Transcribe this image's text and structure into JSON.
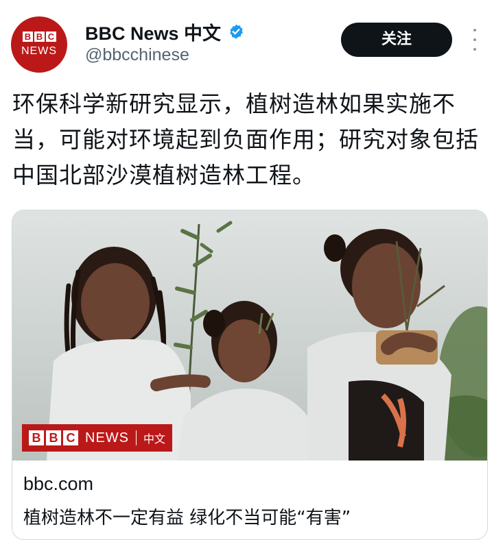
{
  "account": {
    "display_name": "BBC News 中文",
    "handle": "@bbcchinese",
    "avatar_blocks": [
      "B",
      "B",
      "C"
    ],
    "avatar_word": "NEWS",
    "verified_icon": "verified-badge-icon",
    "follow_label": "关注",
    "more_icon": "more-vertical-icon"
  },
  "tweet": {
    "text": "环保科学新研究显示，植树造林如果实施不当，可能对环境起到负面作用；研究对象包括中国北部沙漠植树造林工程。"
  },
  "card": {
    "image_badge": {
      "blocks": [
        "B",
        "B",
        "C"
      ],
      "word": "NEWS",
      "zh": "中文"
    },
    "domain": "bbc.com",
    "title": "植树造林不一定有益 绿化不当可能“有害”"
  },
  "colors": {
    "bbc_red": "#bb1919",
    "follow_bg": "#0f1419",
    "verified_blue": "#1d9bf0",
    "handle_gray": "#536471"
  }
}
